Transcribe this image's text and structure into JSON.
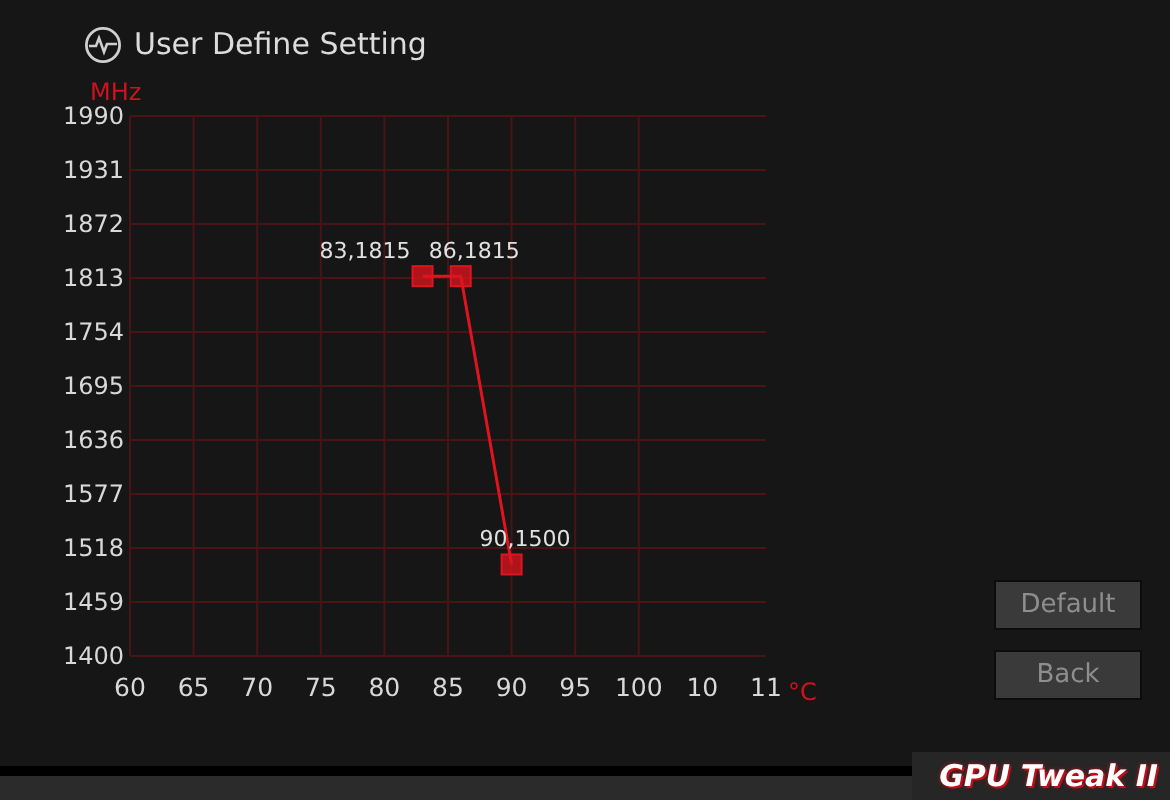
{
  "window": {
    "title": "User Define Setting"
  },
  "chart": {
    "chart_data": {
      "type": "line",
      "ylabel": "MHz",
      "xlabel": "°C",
      "xlim": [
        60,
        110
      ],
      "ylim": [
        1400,
        1990
      ],
      "grid": true,
      "xticks": [
        60,
        65,
        70,
        75,
        80,
        85,
        90,
        95,
        100
      ],
      "yticks": [
        1990,
        1931,
        1872,
        1813,
        1754,
        1695,
        1636,
        1577,
        1518,
        1459,
        1400
      ],
      "x": [
        83,
        86,
        90
      ],
      "series": [
        {
          "color": "#e0141e",
          "marker": "square",
          "values": [
            1815,
            1815,
            1500
          ]
        }
      ],
      "annotations": [
        {
          "text": "83,1815",
          "x": 83,
          "y": 1815
        },
        {
          "text": "86,1815",
          "x": 86,
          "y": 1815
        },
        {
          "text": "90,1500",
          "x": 90,
          "y": 1500
        }
      ]
    },
    "cut_tick_labels": [
      "10",
      "11"
    ]
  },
  "buttons": [
    {
      "label": "Default"
    },
    {
      "label": "Back"
    }
  ],
  "brand": {
    "logo": "GPU Tweak II"
  }
}
